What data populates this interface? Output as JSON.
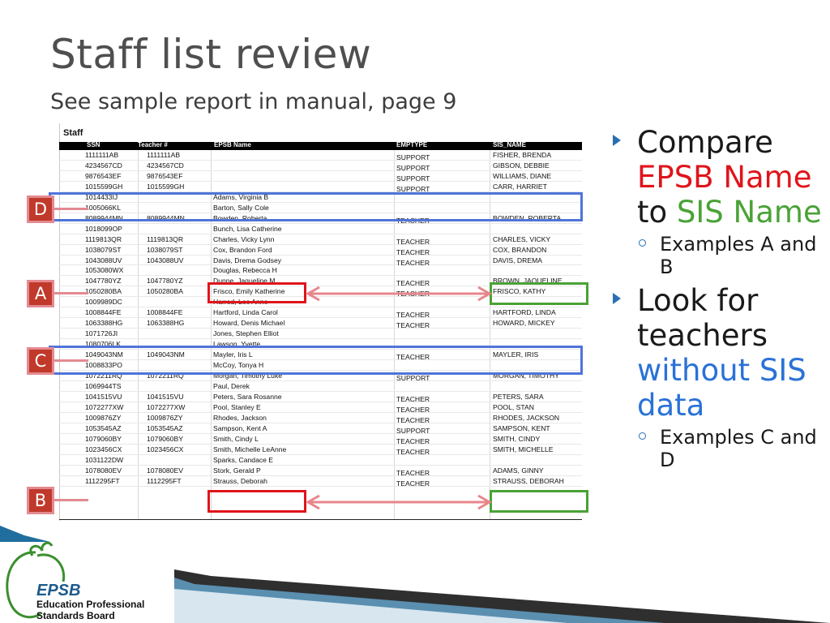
{
  "slide": {
    "title": "Staff list review",
    "subtitle": "See sample report in manual, page 9"
  },
  "report": {
    "title": "Staff",
    "columns": [
      "SSN",
      "Teacher #",
      "EPSB Name",
      "EMPTYPE",
      "SIS_NAME"
    ],
    "rows": [
      {
        "ssn": "1111111AB",
        "teacher": "1111111AB",
        "epsb": "",
        "emptype": "SUPPORT",
        "sis": "FISHER, BRENDA"
      },
      {
        "ssn": "4234567CD",
        "teacher": "4234567CD",
        "epsb": "",
        "emptype": "SUPPORT",
        "sis": "GIBSON, DEBBIE"
      },
      {
        "ssn": "9876543EF",
        "teacher": "9876543EF",
        "epsb": "",
        "emptype": "SUPPORT",
        "sis": "WILLIAMS, DIANE"
      },
      {
        "ssn": "1015599GH",
        "teacher": "1015599GH",
        "epsb": "",
        "emptype": "SUPPORT",
        "sis": "CARR, HARRIET"
      },
      {
        "ssn": "1014433IJ",
        "teacher": "",
        "epsb": "Adams, Virginia B",
        "emptype": "",
        "sis": ""
      },
      {
        "ssn": "1005066KL",
        "teacher": "",
        "epsb": "Barton, Sally Cole",
        "emptype": "",
        "sis": ""
      },
      {
        "ssn": "8089944MN",
        "teacher": "8089944MN",
        "epsb": "Bowden, Roberta",
        "emptype": "TEACHER",
        "sis": "BOWDEN, ROBERTA"
      },
      {
        "ssn": "1018099OP",
        "teacher": "",
        "epsb": "Bunch, Lisa Catherine",
        "emptype": "",
        "sis": ""
      },
      {
        "ssn": "1119813QR",
        "teacher": "1119813QR",
        "epsb": "Charles, Vicky Lynn",
        "emptype": "TEACHER",
        "sis": "CHARLES, VICKY"
      },
      {
        "ssn": "1038079ST",
        "teacher": "1038079ST",
        "epsb": "Cox, Brandon Ford",
        "emptype": "TEACHER",
        "sis": "COX, BRANDON"
      },
      {
        "ssn": "1043088UV",
        "teacher": "1043088UV",
        "epsb": "Davis, Drema Godsey",
        "emptype": "TEACHER",
        "sis": "DAVIS, DREMA"
      },
      {
        "ssn": "1053080WX",
        "teacher": "",
        "epsb": "Douglas, Rebecca H",
        "emptype": "",
        "sis": ""
      },
      {
        "ssn": "1047780YZ",
        "teacher": "1047780YZ",
        "epsb": "Dunne, Jaqueline M",
        "emptype": "TEACHER",
        "sis": "BROWN, JAQUELINE"
      },
      {
        "ssn": "1050280BA",
        "teacher": "1050280BA",
        "epsb": "Frisco, Emily Katherine",
        "emptype": "TEACHER",
        "sis": "FRISCO, KATHY"
      },
      {
        "ssn": "1009989DC",
        "teacher": "",
        "epsb": "Harrod, Lee Anne",
        "emptype": "",
        "sis": ""
      },
      {
        "ssn": "1008844FE",
        "teacher": "1008844FE",
        "epsb": "Hartford, Linda Carol",
        "emptype": "TEACHER",
        "sis": "HARTFORD, LINDA"
      },
      {
        "ssn": "1063388HG",
        "teacher": "1063388HG",
        "epsb": "Howard, Denis Michael",
        "emptype": "TEACHER",
        "sis": "HOWARD, MICKEY"
      },
      {
        "ssn": "1071726JI",
        "teacher": "",
        "epsb": "Jones, Stephen Elliot",
        "emptype": "",
        "sis": ""
      },
      {
        "ssn": "1080706LK",
        "teacher": "",
        "epsb": "Lawson, Yvette",
        "emptype": "",
        "sis": ""
      },
      {
        "ssn": "1049043NM",
        "teacher": "1049043NM",
        "epsb": "Mayler, Iris L",
        "emptype": "TEACHER",
        "sis": "MAYLER, IRIS"
      },
      {
        "ssn": "1008833PO",
        "teacher": "",
        "epsb": "McCoy, Tonya H",
        "emptype": "",
        "sis": ""
      },
      {
        "ssn": "1072211RQ",
        "teacher": "1072211RQ",
        "epsb": "Morgan, Timothy Luke",
        "emptype": "SUPPORT",
        "sis": "MORGAN, TIMOTHY"
      },
      {
        "ssn": "1069944TS",
        "teacher": "",
        "epsb": "Paul, Derek",
        "emptype": "",
        "sis": ""
      },
      {
        "ssn": "1041515VU",
        "teacher": "1041515VU",
        "epsb": "Peters, Sara Rosanne",
        "emptype": "TEACHER",
        "sis": "PETERS, SARA"
      },
      {
        "ssn": "1072277XW",
        "teacher": "1072277XW",
        "epsb": "Pool, Stanley E",
        "emptype": "TEACHER",
        "sis": "POOL, STAN"
      },
      {
        "ssn": "1009876ZY",
        "teacher": "1009876ZY",
        "epsb": "Rhodes, Jackson",
        "emptype": "TEACHER",
        "sis": "RHODES, JACKSON"
      },
      {
        "ssn": "1053545AZ",
        "teacher": "1053545AZ",
        "epsb": "Sampson, Kent A",
        "emptype": "SUPPORT",
        "sis": "SAMPSON, KENT"
      },
      {
        "ssn": "1079060BY",
        "teacher": "1079060BY",
        "epsb": "Smith, Cindy L",
        "emptype": "TEACHER",
        "sis": "SMITH, CINDY"
      },
      {
        "ssn": "1023456CX",
        "teacher": "1023456CX",
        "epsb": "Smith, Michelle LeAnne",
        "emptype": "TEACHER",
        "sis": "SMITH, MICHELLE"
      },
      {
        "ssn": "1031122DW",
        "teacher": "",
        "epsb": "Sparks, Candace E",
        "emptype": "",
        "sis": ""
      },
      {
        "ssn": "1078080EV",
        "teacher": "1078080EV",
        "epsb": "Stork, Gerald P",
        "emptype": "TEACHER",
        "sis": "ADAMS, GINNY"
      },
      {
        "ssn": "1112295FT",
        "teacher": "1112295FT",
        "epsb": "Strauss, Deborah",
        "emptype": "TEACHER",
        "sis": "STRAUSS, DEBORAH"
      }
    ]
  },
  "tags": {
    "a": "A",
    "b": "B",
    "c": "C",
    "d": "D"
  },
  "bullets": {
    "b1": {
      "part1": "Compare ",
      "part2": "EPSB Name",
      "part3": " to ",
      "part4": "SIS Name"
    },
    "b1_sub": "Examples A and B",
    "b2": {
      "part1": "Look for teachers ",
      "part2": "without SIS data"
    },
    "b2_sub": "Examples C and D"
  },
  "colors": {
    "red": "#e0141b",
    "green": "#4aa236",
    "blue": "#2a72d6",
    "highlight_blue": "#4f74d9",
    "tag_fill": "#c0392b"
  },
  "logo": {
    "brand": "EPSB",
    "line1": "Education Professional",
    "line2": "Standards Board"
  }
}
